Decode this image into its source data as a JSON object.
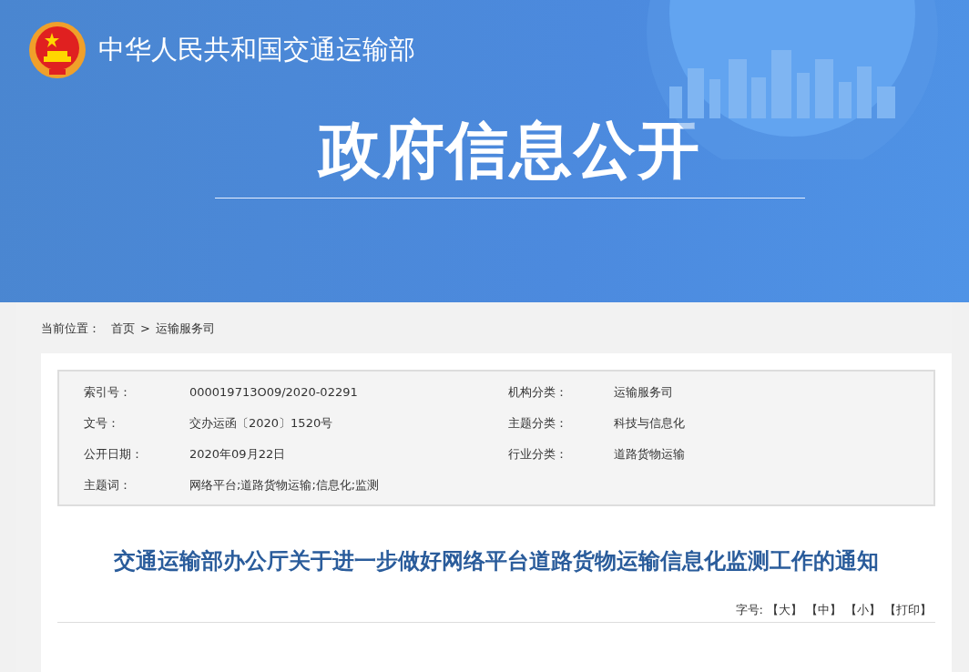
{
  "header": {
    "site_name": "中华人民共和国交通运输部",
    "section_title": "政府信息公开"
  },
  "breadcrumb": {
    "label": "当前位置：",
    "items": [
      {
        "text": "首页"
      },
      {
        "text": "运输服务司"
      }
    ],
    "separator": ">"
  },
  "info_table": {
    "rows": [
      {
        "label": "索引号：",
        "value": "000019713O09/2020-02291",
        "label_2": "机构分类：",
        "value_2": "运输服务司"
      },
      {
        "label": "文号：",
        "value": "交办运函〔2020〕1520号",
        "label_2": "主题分类：",
        "value_2": "科技与信息化"
      },
      {
        "label": "公开日期：",
        "value": "2020年09月22日",
        "label_2": "行业分类：",
        "value_2": "道路货物运输"
      },
      {
        "label": "主题词：",
        "value": "网络平台;道路货物运输;信息化;监测"
      }
    ]
  },
  "article": {
    "title": "交通运输部办公厅关于进一步做好网络平台道路货物运输信息化监测工作的通知"
  },
  "font_size_bar": {
    "label": "字号:",
    "options": [
      {
        "text": "【大】"
      },
      {
        "text": "【中】"
      },
      {
        "text": "【小】"
      },
      {
        "text": "【打印】"
      }
    ]
  }
}
